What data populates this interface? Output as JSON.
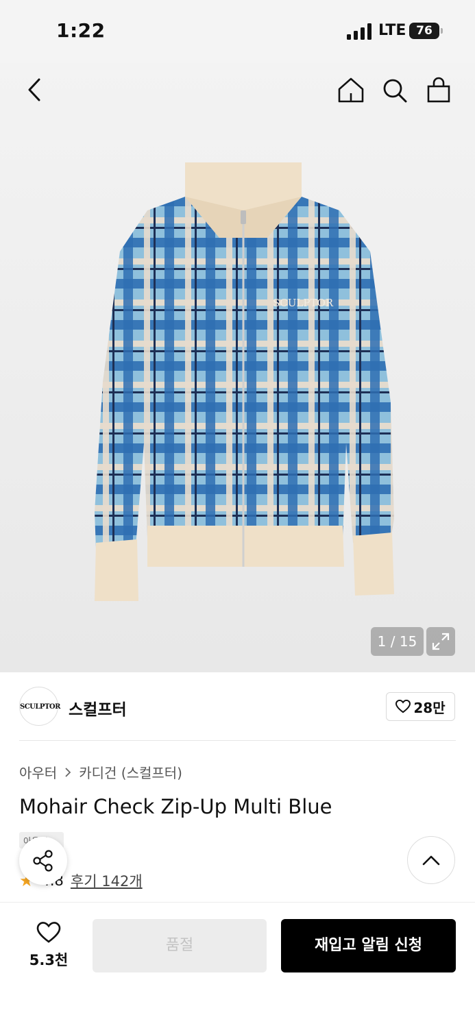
{
  "status_bar": {
    "time": "1:22",
    "network": "LTE",
    "battery": "76"
  },
  "gallery": {
    "counter": "1 / 15",
    "brand_print": "SCULPTOR"
  },
  "brand": {
    "logo_text": "SCULPTOR",
    "name": "스컬프터",
    "likes": "28만"
  },
  "breadcrumb": {
    "level1": "아우터",
    "level2": "카디건 (스컬프터)"
  },
  "product": {
    "title": "Mohair Check Zip-Up Multi Blue",
    "tag": "아울렛",
    "rating": "4.8",
    "reviews": "후기 142개"
  },
  "bottom_bar": {
    "wish_count": "5.3천",
    "soldout_label": "품절",
    "restock_label": "재입고 알림 신청"
  },
  "colors": {
    "sweater_blue": "#2f6fb3",
    "light_blue": "#8fc0dc",
    "cream": "#efe0c8",
    "star": "#f5a623",
    "primary_btn": "#000000"
  },
  "icons": [
    "back-chevron-icon",
    "home-icon",
    "search-icon",
    "shopping-bag-icon",
    "expand-icon",
    "heart-icon",
    "share-icon",
    "chevron-up-icon",
    "star-icon"
  ]
}
